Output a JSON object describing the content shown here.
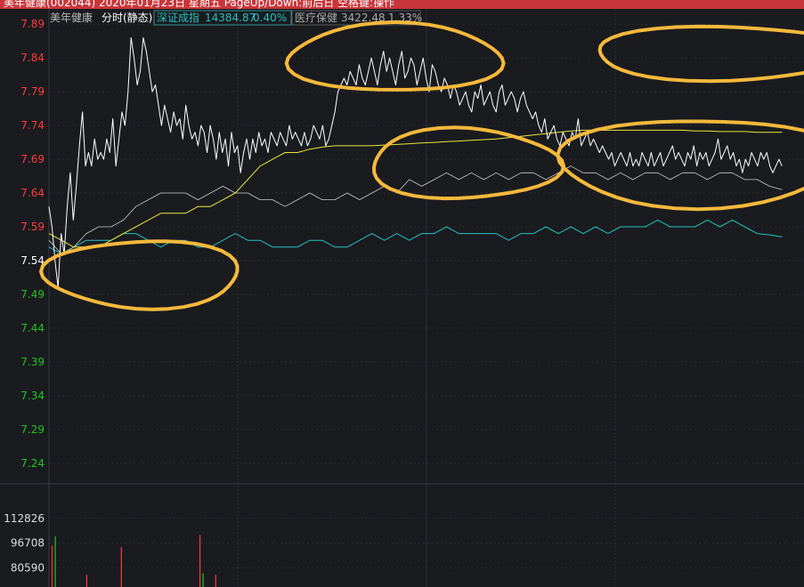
{
  "window": {
    "title": "美年健康(002044) 2020年01月23日 星期五 PageUp/Down:前后日 空格键:操作"
  },
  "header": {
    "stock_name": "美年健康",
    "mode_label": "分时(静态)",
    "index_name": "深证成指",
    "index_value": "14384.87",
    "index_change": "0.40%",
    "sector_name": "医疗保健",
    "sector_value": "3422.48",
    "sector_change": "1.33%"
  },
  "colors": {
    "up": "#ff3b3b",
    "down": "#22c322",
    "flat": "#ffffff",
    "price_line": "#ffffff",
    "avg_line": "#e8e83a",
    "index_line": "#cccccc",
    "sector_line": "#22c1c1",
    "annotation": "#f5b93c",
    "grid": "#2b2c33"
  },
  "chart_data": [
    {
      "type": "line",
      "title": "分时",
      "y_ticks": [
        "7.89",
        "7.84",
        "7.79",
        "7.74",
        "7.69",
        "7.64",
        "7.59",
        "7.54",
        "7.49",
        "7.44",
        "7.39",
        "7.34",
        "7.29",
        "7.24"
      ],
      "ylim": [
        7.22,
        7.91
      ],
      "reference_price": 7.54,
      "x_minutes": 240,
      "series": [
        {
          "name": "价格",
          "values": [
            7.62,
            7.59,
            7.54,
            7.5,
            7.58,
            7.55,
            7.62,
            7.67,
            7.6,
            7.65,
            7.71,
            7.76,
            7.68,
            7.7,
            7.68,
            7.72,
            7.69,
            7.7,
            7.69,
            7.72,
            7.7,
            7.75,
            7.68,
            7.72,
            7.76,
            7.74,
            7.79,
            7.87,
            7.84,
            7.8,
            7.82,
            7.87,
            7.85,
            7.82,
            7.79,
            7.8,
            7.77,
            7.74,
            7.77,
            7.75,
            7.73,
            7.76,
            7.74,
            7.75,
            7.72,
            7.77,
            7.74,
            7.72,
            7.73,
            7.71,
            7.74,
            7.73,
            7.7,
            7.74,
            7.72,
            7.69,
            7.73,
            7.7,
            7.72,
            7.68,
            7.73,
            7.7,
            7.71,
            7.67,
            7.7,
            7.72,
            7.69,
            7.72,
            7.7,
            7.73,
            7.71,
            7.72,
            7.7,
            7.73,
            7.72,
            7.71,
            7.73,
            7.72,
            7.71,
            7.74,
            7.72,
            7.73,
            7.72,
            7.71,
            7.73,
            7.71,
            7.72,
            7.74,
            7.73,
            7.72,
            7.74,
            7.71,
            7.72,
            7.74,
            7.76,
            7.79,
            7.8,
            7.81,
            7.8,
            7.82,
            7.81,
            7.8,
            7.83,
            7.81,
            7.8,
            7.82,
            7.84,
            7.82,
            7.8,
            7.83,
            7.85,
            7.82,
            7.84,
            7.82,
            7.8,
            7.83,
            7.85,
            7.81,
            7.82,
            7.84,
            7.83,
            7.8,
            7.82,
            7.84,
            7.81,
            7.79,
            7.83,
            7.82,
            7.8,
            7.79,
            7.81,
            7.8,
            7.78,
            7.8,
            7.79,
            7.77,
            7.78,
            7.79,
            7.77,
            7.76,
            7.79,
            7.78,
            7.8,
            7.77,
            7.78,
            7.79,
            7.77,
            7.76,
            7.79,
            7.8,
            7.77,
            7.78,
            7.79,
            7.78,
            7.76,
            7.78,
            7.79,
            7.77,
            7.76,
            7.75,
            7.76,
            7.74,
            7.73,
            7.75,
            7.72,
            7.73,
            7.74,
            7.72,
            7.71,
            7.73,
            7.72,
            7.71,
            7.73,
            7.72,
            7.75,
            7.71,
            7.72,
            7.73,
            7.71,
            7.72,
            7.71,
            7.7,
            7.71,
            7.7,
            7.69,
            7.7,
            7.68,
            7.69,
            7.7,
            7.69,
            7.68,
            7.7,
            7.68,
            7.69,
            7.68,
            7.7,
            7.69,
            7.68,
            7.7,
            7.68,
            7.69,
            7.7,
            7.68,
            7.69,
            7.7,
            7.71,
            7.69,
            7.7,
            7.69,
            7.68,
            7.7,
            7.69,
            7.71,
            7.68,
            7.7,
            7.69,
            7.7,
            7.68,
            7.69,
            7.7,
            7.72,
            7.69,
            7.7,
            7.71,
            7.69,
            7.7,
            7.68,
            7.69,
            7.67,
            7.69,
            7.68,
            7.7,
            7.69,
            7.68,
            7.7,
            7.69,
            7.7,
            7.68,
            7.67,
            7.68,
            7.69,
            7.68
          ]
        },
        {
          "name": "均价",
          "values": [
            7.58,
            7.57,
            7.56,
            7.56,
            7.56,
            7.57,
            7.58,
            7.59,
            7.6,
            7.61,
            7.61,
            7.61,
            7.62,
            7.62,
            7.63,
            7.64,
            7.66,
            7.68,
            7.69,
            7.7,
            7.7,
            7.705,
            7.708,
            7.71,
            7.71,
            7.71,
            7.71,
            7.711,
            7.712,
            7.713,
            7.714,
            7.715,
            7.716,
            7.717,
            7.718,
            7.719,
            7.72,
            7.722,
            7.724,
            7.726,
            7.728,
            7.73,
            7.732,
            7.733,
            7.733,
            7.733,
            7.733,
            7.733,
            7.733,
            7.733,
            7.733,
            7.733,
            7.732,
            7.732,
            7.731,
            7.731,
            7.731,
            7.73,
            7.73,
            7.73
          ]
        },
        {
          "name": "深证成指",
          "values": [
            7.57,
            7.55,
            7.56,
            7.58,
            7.59,
            7.59,
            7.6,
            7.62,
            7.63,
            7.64,
            7.64,
            7.64,
            7.63,
            7.64,
            7.65,
            7.64,
            7.64,
            7.63,
            7.63,
            7.62,
            7.63,
            7.64,
            7.63,
            7.63,
            7.64,
            7.63,
            7.64,
            7.65,
            7.64,
            7.66,
            7.65,
            7.66,
            7.67,
            7.66,
            7.67,
            7.66,
            7.67,
            7.66,
            7.67,
            7.67,
            7.66,
            7.67,
            7.68,
            7.67,
            7.67,
            7.66,
            7.67,
            7.66,
            7.67,
            7.67,
            7.66,
            7.67,
            7.67,
            7.66,
            7.67,
            7.67,
            7.66,
            7.66,
            7.65,
            7.645
          ]
        },
        {
          "name": "医疗保健",
          "values": [
            7.56,
            7.55,
            7.56,
            7.57,
            7.57,
            7.57,
            7.58,
            7.58,
            7.57,
            7.56,
            7.57,
            7.57,
            7.56,
            7.56,
            7.57,
            7.58,
            7.57,
            7.57,
            7.56,
            7.56,
            7.56,
            7.57,
            7.57,
            7.56,
            7.56,
            7.57,
            7.58,
            7.57,
            7.58,
            7.57,
            7.58,
            7.58,
            7.59,
            7.58,
            7.58,
            7.58,
            7.58,
            7.57,
            7.58,
            7.58,
            7.59,
            7.58,
            7.59,
            7.58,
            7.59,
            7.58,
            7.59,
            7.59,
            7.59,
            7.6,
            7.59,
            7.59,
            7.59,
            7.6,
            7.59,
            7.6,
            7.59,
            7.58,
            7.578,
            7.575
          ]
        }
      ]
    },
    {
      "type": "bar",
      "title": "成交量",
      "y_ticks": [
        "112826",
        "96708",
        "80590"
      ],
      "ylim": [
        68000,
        128944
      ],
      "bars": [
        {
          "minute": 1,
          "value": 95000,
          "dir": "up"
        },
        {
          "minute": 2,
          "value": 101000,
          "dir": "down"
        },
        {
          "minute": 12,
          "value": 76000,
          "dir": "up"
        },
        {
          "minute": 23,
          "value": 94000,
          "dir": "up"
        },
        {
          "minute": 48,
          "value": 102000,
          "dir": "up"
        },
        {
          "minute": 49,
          "value": 77000,
          "dir": "down"
        },
        {
          "minute": 53,
          "value": 76000,
          "dir": "up"
        }
      ]
    }
  ],
  "annotations": [
    {
      "name": "circle-top-left",
      "cx": 110,
      "cy": 7.84,
      "rx": 34,
      "ry": 0.05
    },
    {
      "name": "circle-mid-left",
      "cx": 132,
      "cy": 7.683,
      "rx": 30,
      "ry": 0.052
    },
    {
      "name": "circle-top-mid",
      "cx": 215,
      "cy": 7.847,
      "rx": 42,
      "ry": 0.04
    },
    {
      "name": "circle-right",
      "cx": 207,
      "cy": 7.685,
      "rx": 45,
      "ry": 0.065
    },
    {
      "name": "circle-low-left",
      "cx": 30,
      "cy": 7.52,
      "rx": 31,
      "ry": 0.05
    }
  ]
}
